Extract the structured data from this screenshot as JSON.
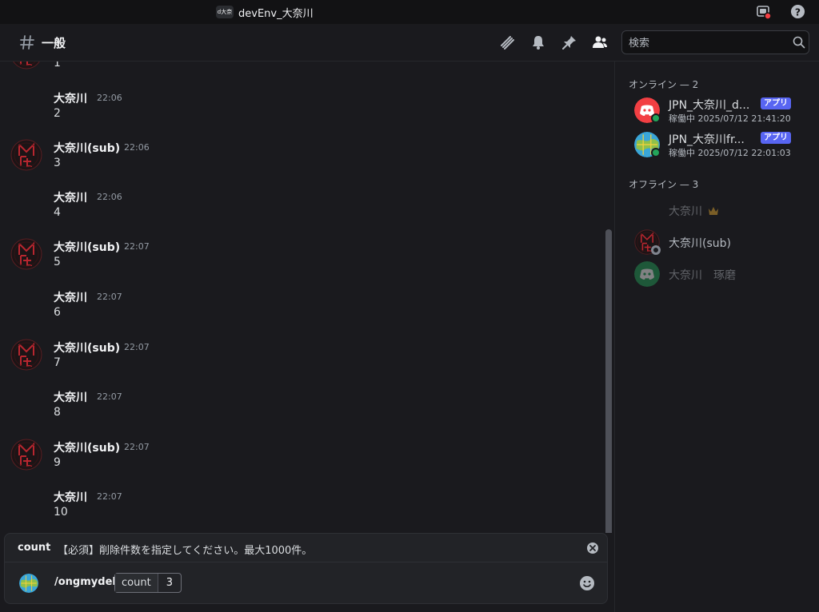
{
  "titlebar": {
    "server_badge": "d大奈",
    "title": "devEnv_大奈川",
    "icons": [
      "inbox-icon",
      "help-icon"
    ]
  },
  "channel": {
    "name": "一般",
    "header_icons": [
      "threads-icon",
      "bell-icon",
      "pin-icon",
      "members-icon"
    ],
    "search_placeholder": "検索"
  },
  "messages": {
    "fragment_content": "1",
    "items": [
      {
        "author": "大奈川",
        "time": "22:06",
        "content": "2"
      },
      {
        "author": "大奈川(sub)",
        "time": "22:06",
        "content": "3"
      },
      {
        "author": "大奈川",
        "time": "22:06",
        "content": "4"
      },
      {
        "author": "大奈川(sub)",
        "time": "22:07",
        "content": "5"
      },
      {
        "author": "大奈川",
        "time": "22:07",
        "content": "6"
      },
      {
        "author": "大奈川(sub)",
        "time": "22:07",
        "content": "7"
      },
      {
        "author": "大奈川",
        "time": "22:07",
        "content": "8"
      },
      {
        "author": "大奈川(sub)",
        "time": "22:07",
        "content": "9"
      },
      {
        "author": "大奈川",
        "time": "22:07",
        "content": "10"
      }
    ]
  },
  "composer": {
    "hint": {
      "option_name": "count",
      "description": "【必須】削除件数を指定してください。最大1000件。"
    },
    "command": {
      "name": "/ongmydel",
      "option_name": "count",
      "option_value": "3"
    }
  },
  "members": {
    "online_title": "オンライン — 2",
    "offline_title": "オフライン — 3",
    "online": [
      {
        "name": "JPN_大奈川_d...",
        "badge": "アプリ",
        "status": "稼働中 2025/07/12 21:41:20"
      },
      {
        "name": "JPN_大奈川fr...",
        "badge": "アプリ",
        "status": "稼働中 2025/07/12 22:01:03"
      }
    ],
    "offline": [
      {
        "name": "大奈川"
      },
      {
        "name": "大奈川(sub)"
      },
      {
        "name": "大奈川　琢磨"
      }
    ]
  },
  "colors": {
    "accent": "#5865f2",
    "online": "#23a55a",
    "danger": "#f23f43",
    "background": "#1a1a1e",
    "crown": "#f0b232"
  }
}
